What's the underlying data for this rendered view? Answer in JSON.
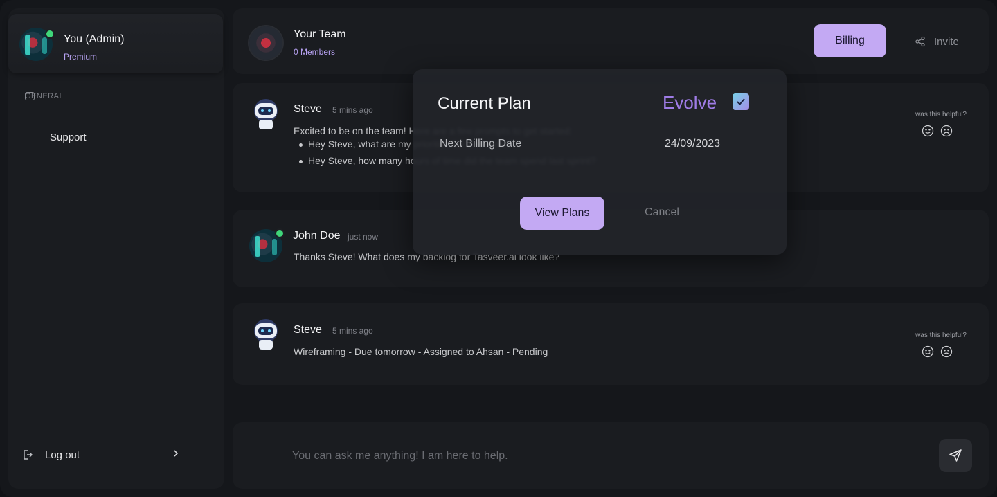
{
  "sidebar": {
    "user": {
      "name": "You (Admin)",
      "plan": "Premium"
    },
    "section_label": "GENERAL",
    "items": [
      {
        "label": "Support"
      }
    ],
    "logout_label": "Log out"
  },
  "header": {
    "team_name": "Your Team",
    "members": "0 Members",
    "billing_label": "Billing",
    "invite_label": "Invite"
  },
  "messages": [
    {
      "sender": "Steve",
      "time": "5 mins ago",
      "text": "Excited to be on the team! Here are a few prompts to get started:",
      "bullets": [
        "Hey Steve,  what are my priorities for this week?",
        "Hey Steve, how many hours of time did the team spend last sprint?"
      ],
      "helpful_label": "was this helpful?"
    },
    {
      "sender": "John Doe",
      "time": "just now",
      "text": "Thanks Steve! What does my backlog for Tasveer.ai look like?"
    },
    {
      "sender": "Steve",
      "time": "5 mins ago",
      "text": "Wireframing  - Due tomorrow - Assigned to Ahsan - Pending",
      "helpful_label": "was this helpful?"
    }
  ],
  "composer": {
    "placeholder": "You can ask me anything! I am here to help."
  },
  "modal": {
    "title": "Current Plan",
    "plan_name": "Evolve",
    "billing_label": "Next Billing Date",
    "billing_date": "24/09/2023",
    "view_plans_label": "View Plans",
    "cancel_label": "Cancel"
  },
  "colors": {
    "accent": "#c3a9f3",
    "plan_text": "#9f7ce6",
    "online": "#3fd67a",
    "background": "#15171b",
    "panel": "#1a1c20"
  }
}
